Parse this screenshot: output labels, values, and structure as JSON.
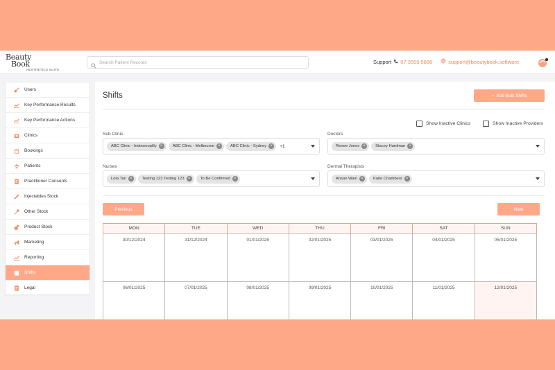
{
  "brand": {
    "line1": "Beauty",
    "line2": "Book",
    "tagline": "AESTHETICS SUITE"
  },
  "search": {
    "placeholder": "Search Patient Records"
  },
  "support": {
    "label": "Support",
    "phone": "07 3555 5886",
    "email": "support@beautybook.software"
  },
  "sidebar": {
    "items": [
      {
        "label": "Users",
        "icon": "key-icon"
      },
      {
        "label": "Key Performance Results",
        "icon": "chart-line-icon"
      },
      {
        "label": "Key Performance Actions",
        "icon": "chart-line-icon"
      },
      {
        "label": "Clinics",
        "icon": "clinic-icon"
      },
      {
        "label": "Bookings",
        "icon": "calendar-icon"
      },
      {
        "label": "Patients",
        "icon": "users-icon"
      },
      {
        "label": "Practitioner Consents",
        "icon": "document-icon"
      },
      {
        "label": "Injectables Stock",
        "icon": "syringe-icon"
      },
      {
        "label": "Other Stock",
        "icon": "dropper-icon"
      },
      {
        "label": "Product Stock",
        "icon": "product-icon"
      },
      {
        "label": "Marketing",
        "icon": "megaphone-icon"
      },
      {
        "label": "Reporting",
        "icon": "chart-line-icon"
      },
      {
        "label": "Shifts",
        "icon": "calendar-check-icon",
        "active": true
      },
      {
        "label": "Legal",
        "icon": "document-icon"
      }
    ]
  },
  "page": {
    "title": "Shifts",
    "bulk_button": "Add Bulk Shifts"
  },
  "filters": {
    "show_inactive_clinics": "Show Inactive Clinics",
    "show_inactive_providers": "Show Inactive Providers",
    "sub_clinic": {
      "label": "Sub Clinic",
      "chips": [
        "ABC Clinic - Indooroopilly",
        "ABC Clinic - Melbourne",
        "ABC Clinic - Sydney"
      ],
      "more": "+1"
    },
    "doctors": {
      "label": "Doctors",
      "chips": [
        "Renee Jones",
        "Stacey Hardman"
      ]
    },
    "nurses": {
      "label": "Nurses",
      "chips": [
        "Lola Tan",
        "Testing 123 Testing 123",
        "To Be Confirmed"
      ]
    },
    "dermal": {
      "label": "Dermal Therapists",
      "chips": [
        "Ahsan Wain",
        "Katie Chambers"
      ]
    }
  },
  "nav": {
    "previous": "Previous",
    "next": "Next"
  },
  "calendar": {
    "days": [
      "MON",
      "TUE",
      "WED",
      "THU",
      "FRI",
      "SAT",
      "SUN"
    ],
    "week1": [
      "30/12/2024",
      "31/12/2024",
      "01/01/2025",
      "02/01/2025",
      "03/01/2025",
      "04/01/2025",
      "05/01/2025"
    ],
    "week2": [
      "06/01/2025",
      "07/01/2025",
      "08/01/2025",
      "09/01/2025",
      "10/01/2025",
      "11/01/2025",
      "12/01/2025"
    ]
  },
  "colors": {
    "accent": "#ffa888",
    "accent_text": "#f08a5d",
    "background": "#f4f4f6"
  }
}
